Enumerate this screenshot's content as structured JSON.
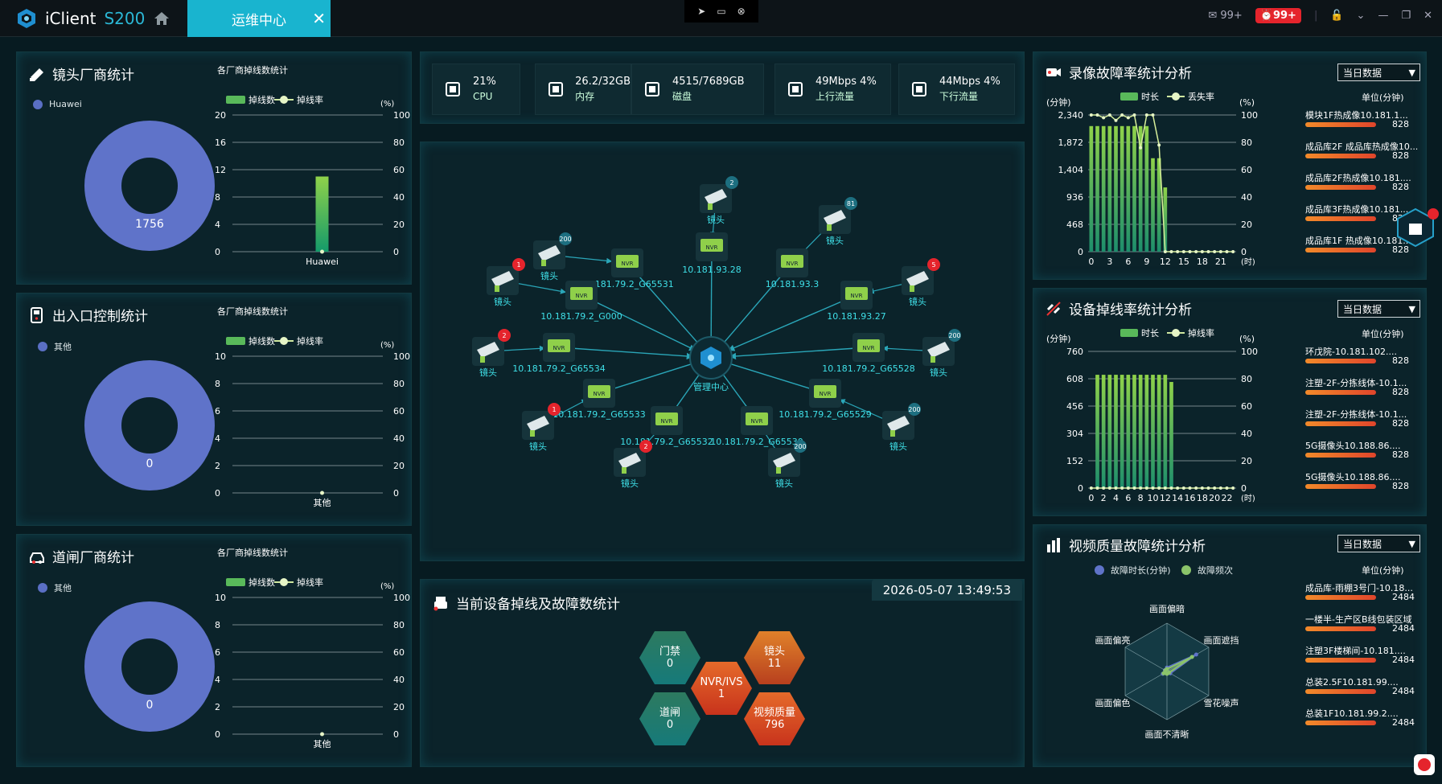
{
  "app": {
    "name": "iClient",
    "version": "S200",
    "tab": "运维中心",
    "msg_count": "99+",
    "alarm_count": "99+"
  },
  "lens": {
    "title": "镜头厂商统计",
    "legend": "Huawei",
    "total": "1756",
    "sub": "各厂商掉线数统计",
    "leg1": "掉线数",
    "leg2": "掉线率",
    "pct": "(%)",
    "yl": [
      "20",
      "16",
      "12",
      "8",
      "4",
      "0"
    ],
    "yr": [
      "100",
      "80",
      "60",
      "40",
      "20",
      "0"
    ],
    "cat": "Huawei"
  },
  "access": {
    "title": "出入口控制统计",
    "legend": "其他",
    "total": "0",
    "sub": "各厂商掉线数统计",
    "leg1": "掉线数",
    "leg2": "掉线率",
    "pct": "(%)",
    "yl": [
      "10",
      "8",
      "6",
      "4",
      "2",
      "0"
    ],
    "yr": [
      "100",
      "80",
      "60",
      "40",
      "20",
      "0"
    ],
    "cat": "其他"
  },
  "gate": {
    "title": "道闸厂商统计",
    "legend": "其他",
    "total": "0",
    "sub": "各厂商掉线数统计",
    "leg1": "掉线数",
    "leg2": "掉线率",
    "pct": "(%)",
    "yl": [
      "10",
      "8",
      "6",
      "4",
      "2",
      "0"
    ],
    "yr": [
      "100",
      "80",
      "60",
      "40",
      "20",
      "0"
    ],
    "cat": "其他"
  },
  "stats": [
    {
      "v": "21%",
      "l": "CPU"
    },
    {
      "v": "26.2/32GB",
      "l": "内存"
    },
    {
      "v": "4515/7689GB",
      "l": "磁盘"
    },
    {
      "v": "49Mbps 4%",
      "l": "上行流量"
    },
    {
      "v": "44Mbps 4%",
      "l": "下行流量"
    }
  ],
  "topo": {
    "center": "管理中心",
    "cam": "镜头",
    "nvr": "NVR",
    "labels": [
      "10.181.79.2_G65531",
      "10.181.93.28",
      "10.181.93.3",
      "10.181.79.2_G000",
      "10.181.93.27",
      "10.181.79.2_G65534",
      "10.181.79.2_G65528",
      "10.181.79.2_G65533",
      "10.181.79.2_G65529",
      "10.181.79.2_G65532",
      "10.181.79.2_G65530"
    ],
    "badges": [
      "200",
      "2",
      "81",
      "1",
      "5",
      "2",
      "200",
      "1",
      "200",
      "2",
      "200"
    ]
  },
  "fault": {
    "title": "当前设备掉线及故障数统计",
    "datetime": "2026-05-07 13:49:53",
    "hex": [
      {
        "k": "门禁",
        "v": "0"
      },
      {
        "k": "镜头",
        "v": "11"
      },
      {
        "k": "NVR/IVS",
        "v": "1"
      },
      {
        "k": "道闸",
        "v": "0"
      },
      {
        "k": "视频质量",
        "v": "796"
      }
    ]
  },
  "rec": {
    "title": "录像故障率统计分析",
    "dd": "当日数据",
    "leg1": "时长",
    "leg2": "丢失率",
    "unit": "(分钟)",
    "pct": "(%)",
    "unit2": "单位(分钟)",
    "hour": "(时)",
    "yl": [
      "2,340",
      "1,872",
      "1,404",
      "936",
      "468",
      "0"
    ],
    "yr": [
      "100",
      "80",
      "60",
      "40",
      "20",
      "0"
    ],
    "xt": [
      "0",
      "3",
      "6",
      "9",
      "12",
      "15",
      "18",
      "21"
    ],
    "list": [
      {
        "n": "模块1F热成像10.181.1...",
        "v": "828"
      },
      {
        "n": "成品库2F 成品库热成像10...",
        "v": "828"
      },
      {
        "n": "成品库2F热成像10.181....",
        "v": "828"
      },
      {
        "n": "成品库3F热成像10.181...",
        "v": "828"
      },
      {
        "n": "成品库1F 热成像10.181...",
        "v": "828"
      }
    ]
  },
  "drop": {
    "title": "设备掉线率统计分析",
    "dd": "当日数据",
    "leg1": "时长",
    "leg2": "掉线率",
    "unit": "(分钟)",
    "pct": "(%)",
    "unit2": "单位(分钟)",
    "hour": "(时)",
    "yl": [
      "760",
      "608",
      "456",
      "304",
      "152",
      "0"
    ],
    "yr": [
      "100",
      "80",
      "60",
      "40",
      "20",
      "0"
    ],
    "xt": [
      "0",
      "2",
      "4",
      "6",
      "8",
      "10",
      "12",
      "14",
      "16",
      "18",
      "20",
      "22"
    ],
    "list": [
      {
        "n": "环戊院-10.181.102....",
        "v": "828"
      },
      {
        "n": "注塑-2F-分拣线体-10.1...",
        "v": "828"
      },
      {
        "n": "注塑-2F-分拣线体-10.1...",
        "v": "828"
      },
      {
        "n": "5G摄像头10.188.86....",
        "v": "828"
      },
      {
        "n": "5G摄像头10.188.86....",
        "v": "828"
      }
    ]
  },
  "vq": {
    "title": "视频质量故障统计分析",
    "dd": "当日数据",
    "leg1": "故障时长(分钟)",
    "leg2": "故障频次",
    "unit2": "单位(分钟)",
    "axes": [
      "画面偏暗",
      "画面遮挡",
      "雪花噪声",
      "画面不清晰",
      "画面偏色",
      "画面偏亮"
    ],
    "list": [
      {
        "n": "成品库-雨棚3号门-10.18...",
        "v": "2484"
      },
      {
        "n": "一楼半-生产区B线包装区域",
        "v": "2484"
      },
      {
        "n": "注塑3F楼梯间-10.181....",
        "v": "2484"
      },
      {
        "n": "总装2.5F10.181.99....",
        "v": "2484"
      },
      {
        "n": "总装1F10.181.99.2....",
        "v": "2484"
      }
    ]
  },
  "chart_data": [
    {
      "type": "bar",
      "title": "各厂商掉线数统计",
      "categories": [
        "Huawei"
      ],
      "series": [
        {
          "name": "掉线数",
          "values": [
            11
          ]
        },
        {
          "name": "掉线率",
          "values": [
            0
          ]
        }
      ],
      "ylim": [
        0,
        20
      ]
    },
    {
      "type": "bar",
      "title": "各厂商掉线数统计",
      "categories": [
        "其他"
      ],
      "series": [
        {
          "name": "掉线数",
          "values": [
            0
          ]
        },
        {
          "name": "掉线率",
          "values": [
            0
          ]
        }
      ],
      "ylim": [
        0,
        10
      ]
    },
    {
      "type": "bar",
      "title": "各厂商掉线数统计",
      "categories": [
        "其他"
      ],
      "series": [
        {
          "name": "掉线数",
          "values": [
            0
          ]
        },
        {
          "name": "掉线率",
          "values": [
            0
          ]
        }
      ],
      "ylim": [
        0,
        10
      ]
    },
    {
      "type": "bar",
      "title": "录像故障率统计分析",
      "x": [
        0,
        1,
        2,
        3,
        4,
        5,
        6,
        7,
        8,
        9,
        10,
        11,
        12,
        13,
        14,
        15,
        16,
        17,
        18,
        19,
        20,
        21,
        22,
        23
      ],
      "series": [
        {
          "name": "时长",
          "values": [
            2150,
            2150,
            2150,
            2150,
            2150,
            2150,
            2150,
            2150,
            2150,
            2150,
            1600,
            1600,
            1100,
            0,
            0,
            0,
            0,
            0,
            0,
            0,
            0,
            0,
            0,
            0
          ]
        },
        {
          "name": "丢失率",
          "values": [
            100,
            100,
            98,
            100,
            96,
            100,
            98,
            100,
            76,
            100,
            100,
            78,
            0,
            0,
            0,
            0,
            0,
            0,
            0,
            0,
            0,
            0,
            0,
            0
          ]
        }
      ],
      "ylim": [
        0,
        2340
      ]
    },
    {
      "type": "bar",
      "title": "设备掉线率统计分析",
      "x": [
        0,
        1,
        2,
        3,
        4,
        5,
        6,
        7,
        8,
        9,
        10,
        11,
        12,
        13,
        14,
        15,
        16,
        17,
        18,
        19,
        20,
        21,
        22,
        23
      ],
      "series": [
        {
          "name": "时长",
          "values": [
            0,
            630,
            630,
            630,
            630,
            630,
            630,
            630,
            630,
            630,
            630,
            630,
            630,
            590,
            0,
            0,
            0,
            0,
            0,
            0,
            0,
            0,
            0,
            0
          ]
        },
        {
          "name": "掉线率",
          "values": [
            0,
            0,
            0,
            0,
            0,
            0,
            0,
            0,
            0,
            0,
            0,
            0,
            0,
            0,
            0,
            0,
            0,
            0,
            0,
            0,
            0,
            0,
            0,
            0
          ]
        }
      ],
      "ylim": [
        0,
        760
      ]
    },
    {
      "type": "radar",
      "title": "视频质量故障统计分析",
      "categories": [
        "画面偏暗",
        "画面遮挡",
        "雪花噪声",
        "画面不清晰",
        "画面偏色",
        "画面偏亮"
      ],
      "series": [
        {
          "name": "故障时长(分钟)",
          "values": [
            0.08,
            0.7,
            0.08,
            0.05,
            0.1,
            0.05
          ]
        },
        {
          "name": "故障频次",
          "values": [
            0.05,
            0.6,
            0.05,
            0.05,
            0.08,
            0.04
          ]
        }
      ]
    }
  ]
}
